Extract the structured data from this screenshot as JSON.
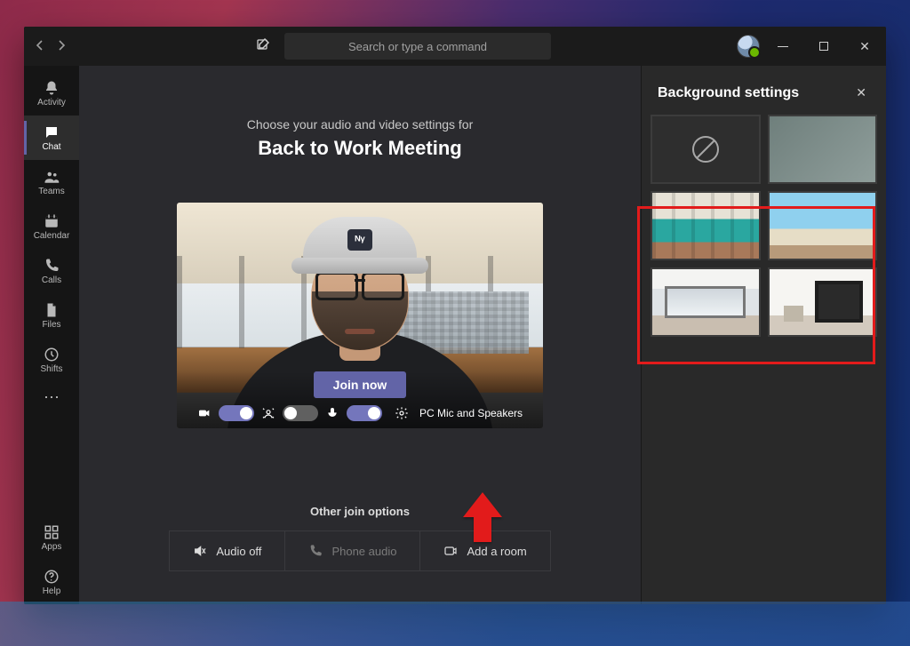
{
  "titlebar": {
    "search_placeholder": "Search or type a command"
  },
  "leftrail": {
    "items": [
      {
        "label": "Activity"
      },
      {
        "label": "Chat"
      },
      {
        "label": "Teams"
      },
      {
        "label": "Calendar"
      },
      {
        "label": "Calls"
      },
      {
        "label": "Files"
      },
      {
        "label": "Shifts"
      }
    ],
    "apps_label": "Apps",
    "help_label": "Help"
  },
  "prejoin": {
    "subtitle": "Choose your audio and video settings for",
    "meeting_title": "Back to Work Meeting",
    "join_label": "Join now",
    "device_label": "PC Mic and Speakers",
    "other_header": "Other join options",
    "options": {
      "audio_off": "Audio off",
      "phone_audio": "Phone audio",
      "add_room": "Add a room"
    },
    "cap_logo": "ᴺᵞ"
  },
  "side_panel": {
    "title": "Background settings"
  }
}
